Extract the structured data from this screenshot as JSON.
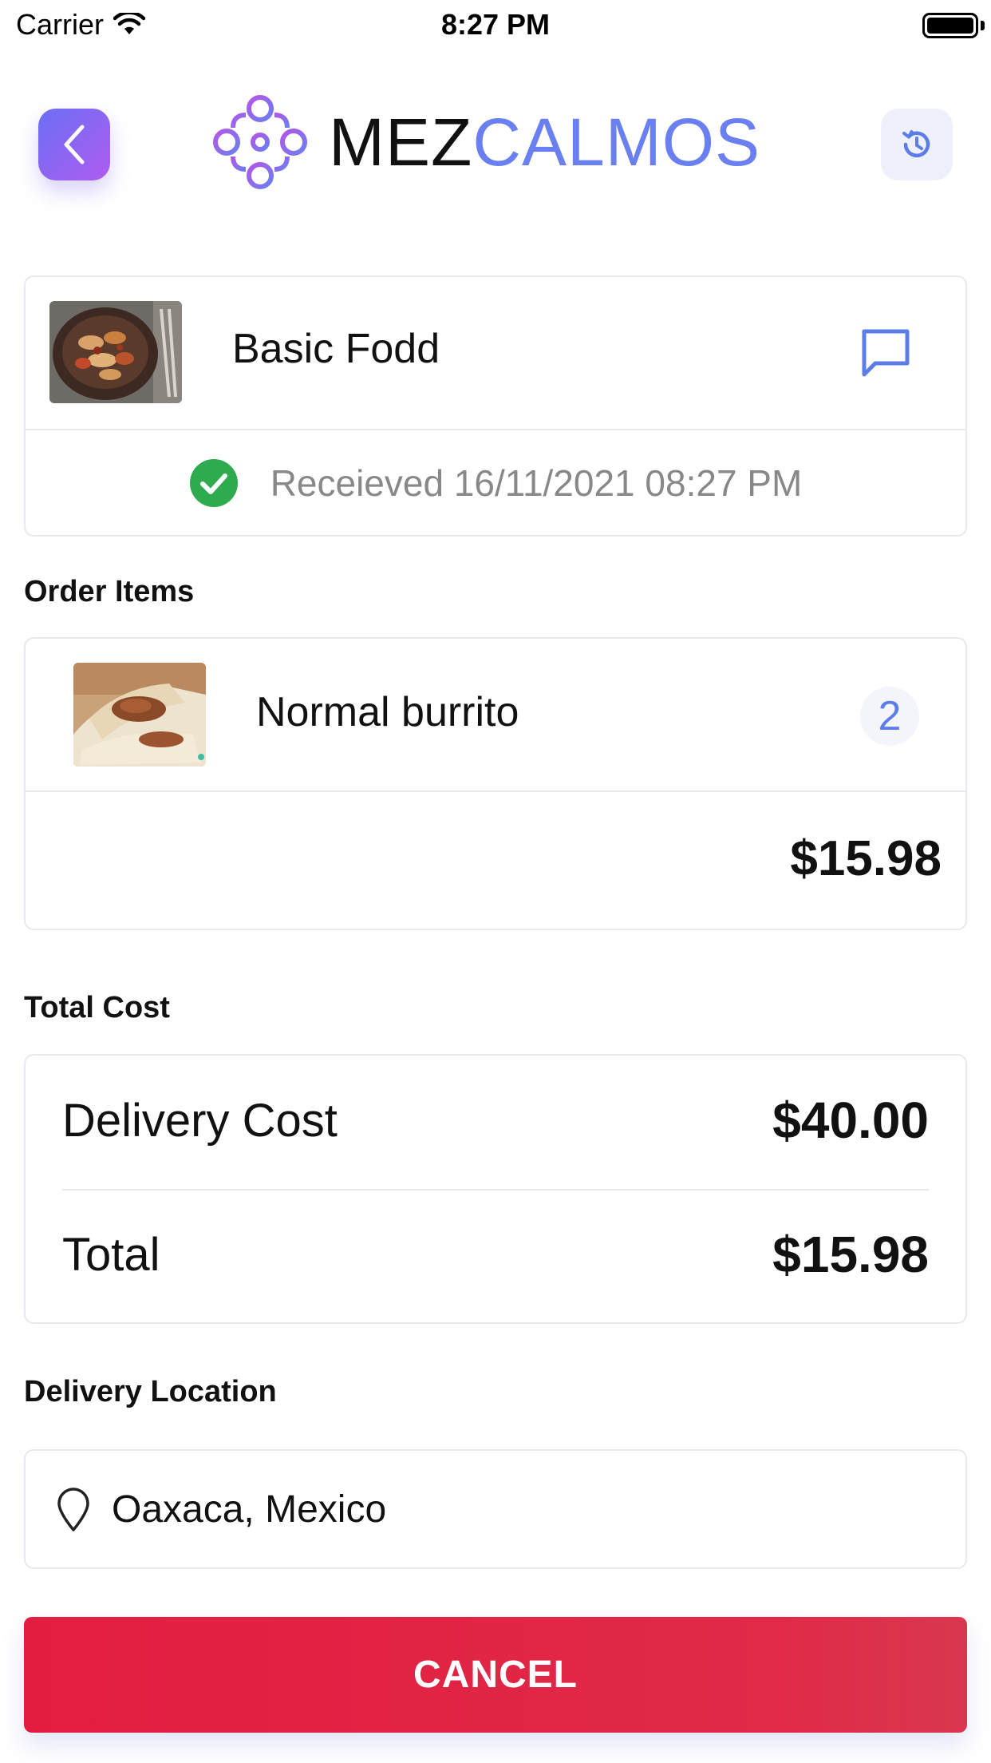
{
  "status_bar": {
    "carrier": "Carrier",
    "time": "8:27 PM",
    "wifi_icon": "wifi-icon",
    "battery_icon": "battery-icon"
  },
  "header": {
    "back_icon": "chevron-left-icon",
    "logo_part1": "MEZ",
    "logo_part2": "CALMOS",
    "history_icon": "history-icon",
    "colors": {
      "brand_dark": "#111111",
      "brand_accent": "#6a7ff0",
      "back_gradient_start": "#6a6ff4",
      "back_gradient_end": "#b05cf0"
    }
  },
  "restaurant": {
    "name": "Basic Fodd",
    "image_icon": "restaurant-photo",
    "chat_icon": "message-icon",
    "status_icon": "check-circle-icon",
    "status_text": "Receieved 16/11/2021 08:27 PM",
    "status_color": "#2eaa4f"
  },
  "order_items": {
    "section_title": "Order Items",
    "items": [
      {
        "name": "Normal burrito",
        "quantity": "2",
        "image_icon": "burrito-photo"
      }
    ],
    "subtotal": "$15.98"
  },
  "total_cost": {
    "section_title": "Total Cost",
    "delivery_label": "Delivery Cost",
    "delivery_value": "$40.00",
    "total_label": "Total",
    "total_value": "$15.98"
  },
  "delivery_location": {
    "section_title": "Delivery Location",
    "pin_icon": "location-pin-icon",
    "address": "Oaxaca, Mexico"
  },
  "actions": {
    "cancel_label": "CANCEL",
    "cancel_color": "#e31d40"
  }
}
